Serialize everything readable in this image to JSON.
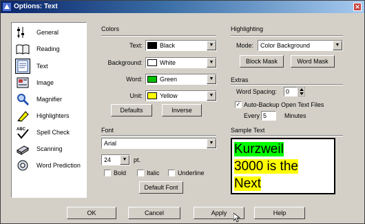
{
  "window": {
    "title": "Options: Text",
    "close_glyph": "✕"
  },
  "sidebar": {
    "items": [
      {
        "label": "General",
        "icon": "sliders-icon"
      },
      {
        "label": "Reading",
        "icon": "open-book-icon"
      },
      {
        "label": "Text",
        "icon": "text-document-icon"
      },
      {
        "label": "Image",
        "icon": "image-icon"
      },
      {
        "label": "Magnifier",
        "icon": "magnifier-icon"
      },
      {
        "label": "Highlighters",
        "icon": "highlighter-icon"
      },
      {
        "label": "Spell Check",
        "icon": "spell-check-icon"
      },
      {
        "label": "Scanning",
        "icon": "scanner-icon"
      },
      {
        "label": "Word Prediction",
        "icon": "word-prediction-icon"
      }
    ],
    "active": "Text"
  },
  "colors": {
    "section_label": "Colors",
    "text_label": "Text:",
    "text_value": "Black",
    "text_swatch": "#000000",
    "background_label": "Background:",
    "background_value": "White",
    "background_swatch": "#ffffff",
    "word_label": "Word:",
    "word_value": "Green",
    "word_swatch": "#00c000",
    "unit_label": "Unit:",
    "unit_value": "Yellow",
    "unit_swatch": "#ffff00",
    "defaults_label": "Defaults",
    "inverse_label": "Inverse"
  },
  "font": {
    "section_label": "Font",
    "family": "Arial",
    "size": "24",
    "size_unit": "pt.",
    "bold_label": "Bold",
    "bold_checked": false,
    "italic_label": "Italic",
    "italic_checked": false,
    "underline_label": "Underline",
    "underline_checked": false,
    "default_font_label": "Default Font"
  },
  "highlighting": {
    "section_label": "Highlighting",
    "mode_label": "Mode:",
    "mode_value": "Color Background",
    "block_mask_label": "Block Mask",
    "word_mask_label": "Word Mask"
  },
  "extras": {
    "section_label": "Extras",
    "word_spacing_label": "Word Spacing:",
    "word_spacing_value": "0",
    "auto_backup_label": "Auto-Backup Open Text Files",
    "auto_backup_checked": true,
    "every_label": "Every",
    "every_value": "5",
    "minutes_label": "Minutes"
  },
  "sample": {
    "section_label": "Sample Text",
    "words": [
      {
        "text": "Kurzweil",
        "hl": "green"
      },
      {
        "text": "3000 is the",
        "hl": "yellow"
      },
      {
        "text": "Next",
        "hl": "yellow"
      }
    ]
  },
  "footer": {
    "ok_label": "OK",
    "cancel_label": "Cancel",
    "apply_label": "Apply",
    "help_label": "Help"
  },
  "checkmark_glyph": "✓",
  "dropdown_glyph": "▼"
}
